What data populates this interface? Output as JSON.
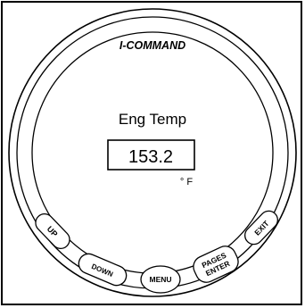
{
  "gauge": {
    "brand": "I-COMMAND",
    "title": "Eng Temp",
    "value": "153.2",
    "unit": "° F"
  },
  "buttons": {
    "up": "UP",
    "down": "DOWN",
    "menu": "MENU",
    "pages_enter_line1": "PAGES",
    "pages_enter_line2": "ENTER",
    "exit": "EXIT"
  }
}
